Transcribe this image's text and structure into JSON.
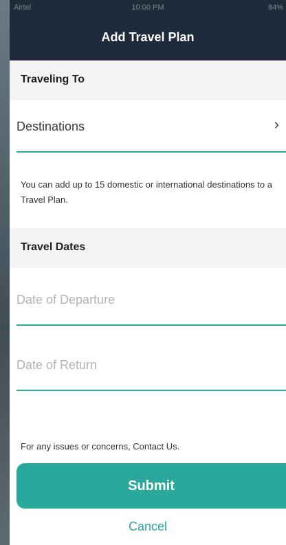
{
  "status_bar": {
    "carrier": "Airtel",
    "time": "10:00 PM",
    "battery": "84%"
  },
  "header": {
    "title": "Add Travel Plan"
  },
  "traveling_to": {
    "section_title": "Traveling To",
    "destinations_label": "Destinations",
    "chevron": "›",
    "info_text": "You can add up to 15 domestic or international destinations to a Travel Plan."
  },
  "travel_dates": {
    "section_title": "Travel Dates",
    "departure_placeholder": "Date of Departure",
    "return_placeholder": "Date of Return"
  },
  "footer": {
    "contact_text": "For any issues or concerns, Contact Us.",
    "submit_label": "Submit",
    "cancel_label": "Cancel"
  },
  "colors": {
    "header_bg": "#1f2b3a",
    "accent": "#2aa89b",
    "section_bg": "#f3f3f3"
  }
}
